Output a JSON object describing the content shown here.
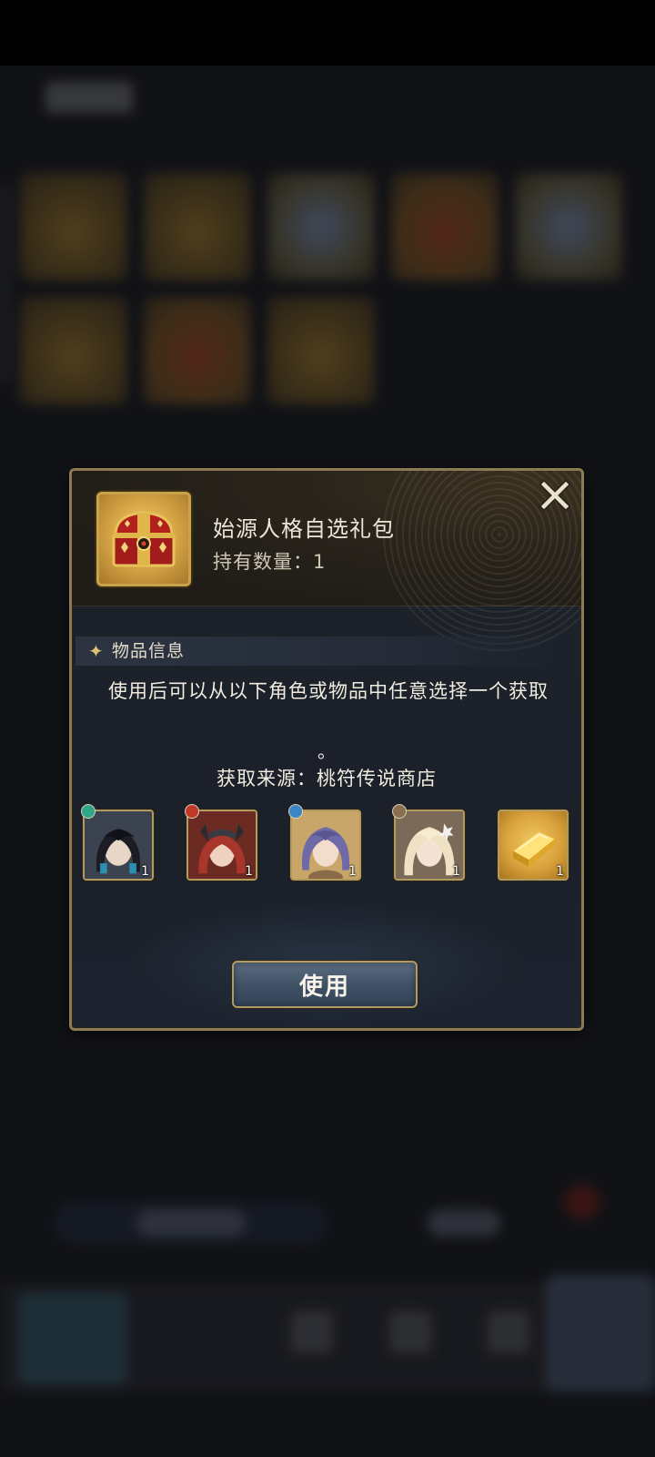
{
  "dialog": {
    "item_name": "始源人格自选礼包",
    "count_text": "持有数量：1",
    "close_label": "X",
    "section_title": "物品信息",
    "description": "使用后可以从以下角色或物品中任意选择一个获取",
    "description_period": "。",
    "source_text": "获取来源：桃符传说商店",
    "rewards": [
      {
        "icon": "character-portrait-dark-hair",
        "element": "teal-element-icon",
        "element_color": "#2fa88a",
        "quantity": "1"
      },
      {
        "icon": "character-portrait-red-horned",
        "element": "red-element-icon",
        "element_color": "#c23a2a",
        "quantity": "1"
      },
      {
        "icon": "character-portrait-purple-hair",
        "element": "blue-element-icon",
        "element_color": "#3a86c2",
        "quantity": "1"
      },
      {
        "icon": "character-portrait-blonde",
        "element": "brown-element-icon",
        "element_color": "#8a7050",
        "quantity": "1"
      },
      {
        "icon": "gold-bar-icon",
        "element": "",
        "element_color": "",
        "quantity": "1"
      }
    ],
    "use_button_label": "使用"
  },
  "colors": {
    "frame_gold": "#8c7a55",
    "button_blue": "#3f5064",
    "text_light": "#f1ece0"
  }
}
